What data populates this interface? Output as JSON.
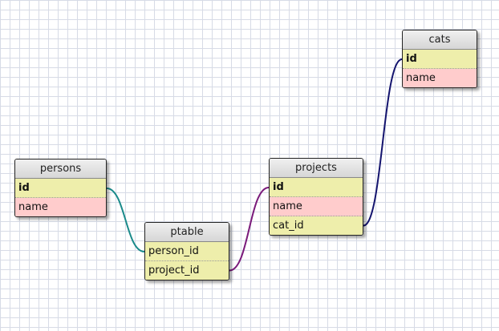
{
  "tables": [
    {
      "id": "persons",
      "name": "persons",
      "fields": [
        {
          "name": "id",
          "kind": "pk"
        },
        {
          "name": "name",
          "kind": "plain"
        }
      ]
    },
    {
      "id": "ptable",
      "name": "ptable",
      "fields": [
        {
          "name": "person_id",
          "kind": "fk"
        },
        {
          "name": "project_id",
          "kind": "fk"
        }
      ]
    },
    {
      "id": "projects",
      "name": "projects",
      "fields": [
        {
          "name": "id",
          "kind": "pk"
        },
        {
          "name": "name",
          "kind": "plain"
        },
        {
          "name": "cat_id",
          "kind": "fk"
        }
      ]
    },
    {
      "id": "cats",
      "name": "cats",
      "fields": [
        {
          "name": "id",
          "kind": "pk"
        },
        {
          "name": "name",
          "kind": "plain"
        }
      ]
    }
  ],
  "relations": [
    {
      "from": "persons.id",
      "to": "ptable.person_id",
      "color": "#1a8a8a"
    },
    {
      "from": "ptable.project_id",
      "to": "projects.id",
      "color": "#7a1a7a"
    },
    {
      "from": "projects.cat_id",
      "to": "cats.id",
      "color": "#14146e"
    }
  ]
}
